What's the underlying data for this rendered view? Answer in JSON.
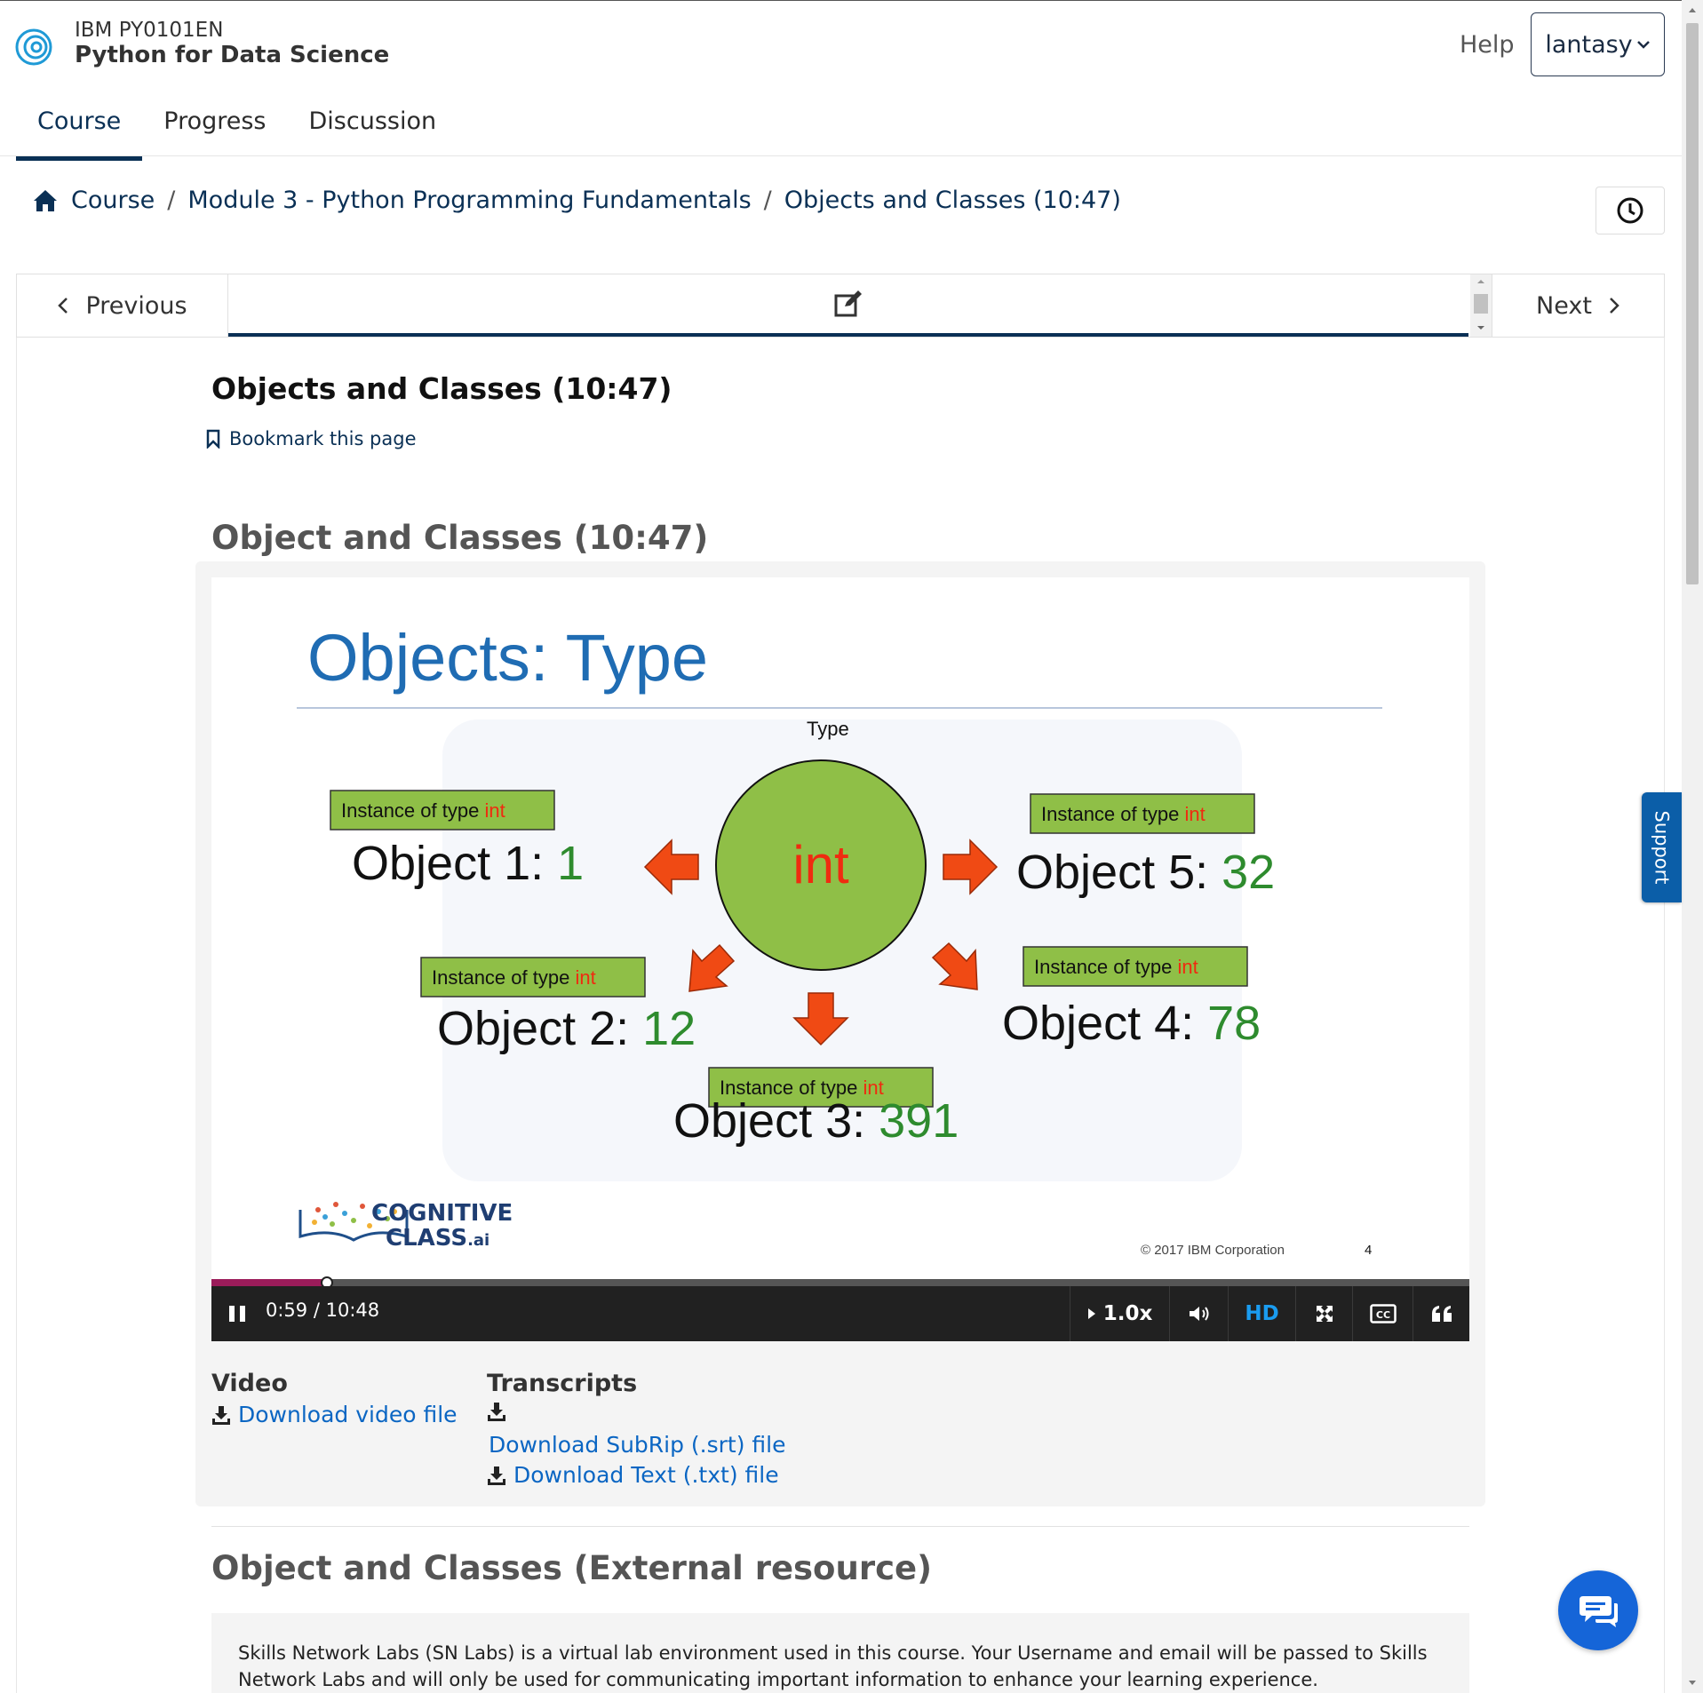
{
  "header": {
    "course_code": "IBM PY0101EN",
    "course_name": "Python for Data Science",
    "help": "Help",
    "username": "lantasy"
  },
  "tabs": [
    {
      "label": "Course",
      "active": true
    },
    {
      "label": "Progress",
      "active": false
    },
    {
      "label": "Discussion",
      "active": false
    }
  ],
  "breadcrumb": {
    "items": [
      "Course",
      "Module 3 - Python Programming Fundamentals",
      "Objects and Classes (10:47)"
    ],
    "separator": "/"
  },
  "sequence_nav": {
    "previous": "Previous",
    "next": "Next"
  },
  "unit": {
    "title": "Objects and Classes (10:47)",
    "bookmark": "Bookmark this page"
  },
  "video": {
    "heading": "Object and Classes (10:47)",
    "slide": {
      "title": "Objects: Type",
      "type_label": "Type",
      "center_label": "int",
      "instance_prefix": "Instance of type",
      "instance_type": "int",
      "objects": [
        {
          "label": "Object 1:",
          "value": "1"
        },
        {
          "label": "Object 2:",
          "value": "12"
        },
        {
          "label": "Object 3:",
          "value": "391"
        },
        {
          "label": "Object 4:",
          "value": "78"
        },
        {
          "label": "Object 5:",
          "value": "32"
        }
      ],
      "logo_line1": "COGNITIVE",
      "logo_line2": "CLASS",
      "logo_suffix": ".ai",
      "copyright": "© 2017 IBM Corporation",
      "slide_number": "4"
    },
    "current_time": "0:59",
    "duration": "10:48",
    "progress_fraction": 0.092,
    "speed": "1.0x",
    "hd": "HD",
    "colors": {
      "progress": "#9b1c5a",
      "hd": "#1a9cf0",
      "circle": "#8fbf47",
      "arrow": "#f04a14",
      "label_box": "#8fbf47"
    }
  },
  "downloads": {
    "video_heading": "Video",
    "video_link": "Download video file",
    "transcripts_heading": "Transcripts",
    "srt_link": "Download SubRip (.srt) file",
    "txt_link": "Download Text (.txt) file"
  },
  "external": {
    "heading": "Object and Classes (External resource)",
    "text": "Skills Network Labs (SN Labs) is a virtual lab environment used in this course. Your Username and email will be passed to Skills Network Labs and will only be used for communicating important information to enhance your learning experience."
  },
  "support": {
    "label": "Support"
  },
  "icons": [
    "ibm-logo-icon",
    "chevron-down-icon",
    "home-icon",
    "clock-icon",
    "chevron-left-icon",
    "edit-icon",
    "chevron-right-icon",
    "bookmark-icon",
    "pause-icon",
    "play-icon",
    "volume-icon",
    "fullscreen-icon",
    "cc-icon",
    "quote-icon",
    "download-icon",
    "chat-icon"
  ]
}
